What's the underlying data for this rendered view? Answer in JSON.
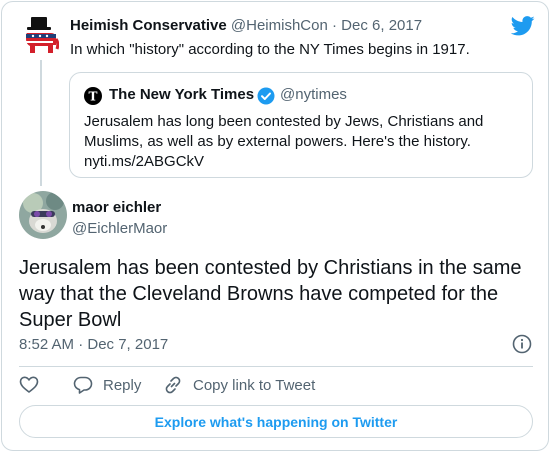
{
  "parent_tweet": {
    "author_name": "Heimish Conservative",
    "handle": "@HeimishCon",
    "separator": "·",
    "date": "Dec 6, 2017",
    "text": "In which \"history\" according to the NY Times begins in 1917."
  },
  "quoted_tweet": {
    "author_name": "The New York Times",
    "handle": "@nytimes",
    "text": "Jerusalem has long been contested by Jews, Christians and Muslims, as well as by external powers. Here's the history. nyti.ms/2ABGCkV"
  },
  "main_tweet": {
    "author_name": "maor eichler",
    "handle": "@EichlerMaor",
    "text": "Jerusalem has been contested by Christians in the same way that the Cleveland Browns have competed for the Super Bowl",
    "timestamp": "8:52 AM · Dec 7, 2017"
  },
  "actions": {
    "reply_label": "Reply",
    "copy_link_label": "Copy link to Tweet"
  },
  "explore_button_label": "Explore what's happening on Twitter",
  "colors": {
    "accent": "#1d9bf0",
    "muted_text": "#536471",
    "border": "#cfd9de",
    "gop_red": "#d3202b",
    "gop_navy": "#1f3e78"
  }
}
